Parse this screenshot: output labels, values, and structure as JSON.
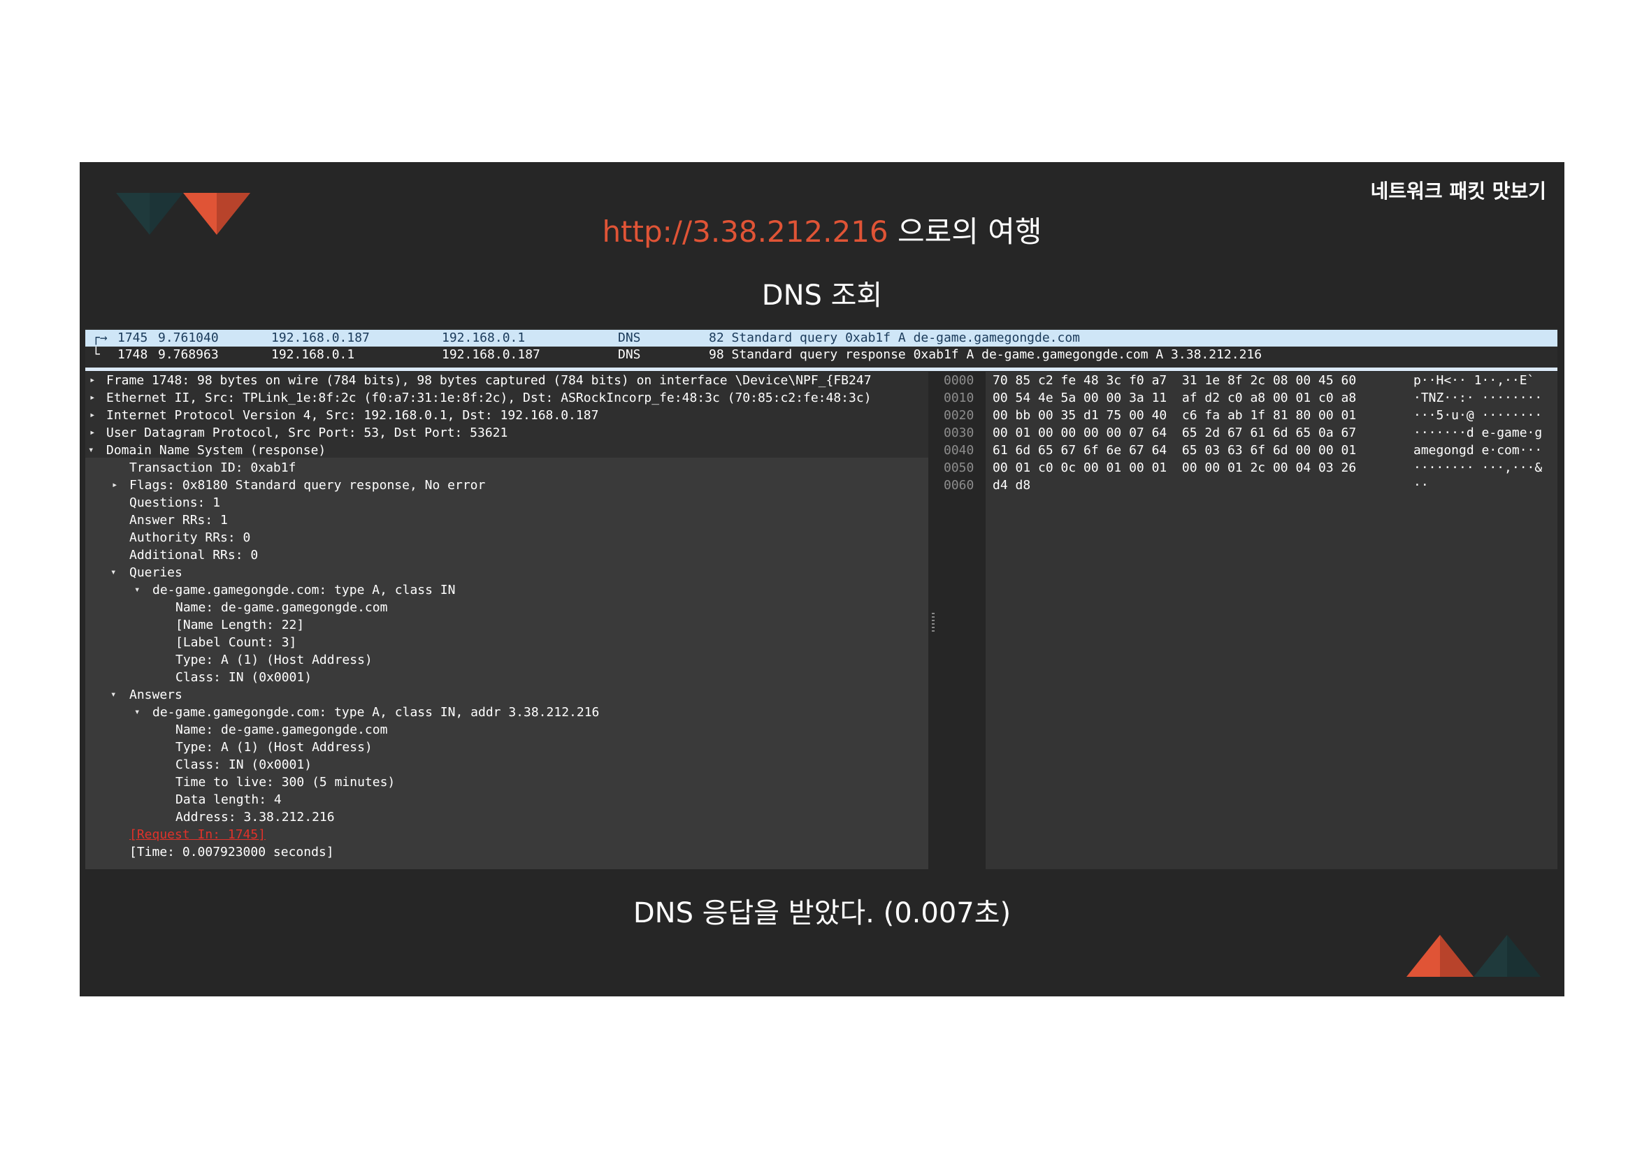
{
  "slide": {
    "corner_title": "네트워크 패킷 맛보기",
    "title_url": "http://3.38.212.216",
    "title_rest": " 으로의 여행",
    "subtitle": "DNS 조회",
    "caption": "DNS 응답을 받았다. (0.007초)",
    "colors": {
      "accent": "#e05436",
      "teal": "#1f3a3c",
      "background": "#262626"
    }
  },
  "packet_list": {
    "rows": [
      {
        "no": "1745",
        "time": "9.761040",
        "src": "192.168.0.187",
        "dst": "192.168.0.1",
        "proto": "DNS",
        "info": "82 Standard query 0xab1f A de-game.gamegongde.com",
        "selected": true
      },
      {
        "no": "1748",
        "time": "9.768963",
        "src": "192.168.0.1",
        "dst": "192.168.0.187",
        "proto": "DNS",
        "info": "98 Standard query response 0xab1f A de-game.gamegongde.com A 3.38.212.216",
        "selected": false
      }
    ]
  },
  "details": {
    "frame": "Frame 1748: 98 bytes on wire (784 bits), 98 bytes captured (784 bits) on interface \\Device\\NPF_{FB247",
    "ethernet": "Ethernet II, Src: TPLink_1e:8f:2c (f0:a7:31:1e:8f:2c), Dst: ASRockIncorp_fe:48:3c (70:85:c2:fe:48:3c)",
    "ip": "Internet Protocol Version 4, Src: 192.168.0.1, Dst: 192.168.0.187",
    "udp": "User Datagram Protocol, Src Port: 53, Dst Port: 53621",
    "dns": "Domain Name System (response)",
    "transaction_id": "Transaction ID: 0xab1f",
    "flags": "Flags: 0x8180 Standard query response, No error",
    "questions": "Questions: 1",
    "answer_rrs": "Answer RRs: 1",
    "authority_rrs": "Authority RRs: 0",
    "additional_rrs": "Additional RRs: 0",
    "queries_label": "Queries",
    "query_entry": "de-game.gamegongde.com: type A, class IN",
    "query_name": "Name: de-game.gamegongde.com",
    "query_name_length": "[Name Length: 22]",
    "query_label_count": "[Label Count: 3]",
    "query_type": "Type: A (1) (Host Address)",
    "query_class": "Class: IN (0x0001)",
    "answers_label": "Answers",
    "answer_entry": "de-game.gamegongde.com: type A, class IN, addr 3.38.212.216",
    "answer_name": "Name: de-game.gamegongde.com",
    "answer_type": "Type: A (1) (Host Address)",
    "answer_class": "Class: IN (0x0001)",
    "answer_ttl": "Time to live: 300 (5 minutes)",
    "answer_data_length": "Data length: 4",
    "answer_address": "Address: 3.38.212.216",
    "request_in": "[Request In: 1745]",
    "time": "[Time: 0.007923000 seconds]"
  },
  "hex_dump": {
    "rows": [
      {
        "offset": "0000",
        "bytes": "70 85 c2 fe 48 3c f0 a7  31 1e 8f 2c 08 00 45 60",
        "ascii": "p··H<·· 1··,··E`"
      },
      {
        "offset": "0010",
        "bytes": "00 54 4e 5a 00 00 3a 11  af d2 c0 a8 00 01 c0 a8",
        "ascii": "·TNZ··:· ········"
      },
      {
        "offset": "0020",
        "bytes": "00 bb 00 35 d1 75 00 40  c6 fa ab 1f 81 80 00 01",
        "ascii": "···5·u·@ ········"
      },
      {
        "offset": "0030",
        "bytes": "00 01 00 00 00 00 07 64  65 2d 67 61 6d 65 0a 67",
        "ascii": "·······d e-game·g"
      },
      {
        "offset": "0040",
        "bytes": "61 6d 65 67 6f 6e 67 64  65 03 63 6f 6d 00 00 01",
        "ascii": "amegongd e·com···"
      },
      {
        "offset": "0050",
        "bytes": "00 01 c0 0c 00 01 00 01  00 00 01 2c 00 04 03 26",
        "ascii": "········ ···,···&"
      },
      {
        "offset": "0060",
        "bytes": "d4 d8",
        "ascii": "··"
      }
    ]
  }
}
